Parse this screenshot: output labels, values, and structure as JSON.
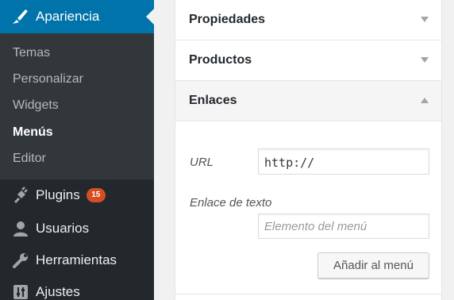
{
  "sidebar": {
    "active": {
      "label": "Apariencia",
      "icon": "brush-icon"
    },
    "submenu": [
      {
        "label": "Temas",
        "current": false
      },
      {
        "label": "Personalizar",
        "current": false
      },
      {
        "label": "Widgets",
        "current": false
      },
      {
        "label": "Menús",
        "current": true
      },
      {
        "label": "Editor",
        "current": false
      }
    ],
    "items": [
      {
        "label": "Plugins",
        "icon": "plugin-icon",
        "badge": "15"
      },
      {
        "label": "Usuarios",
        "icon": "user-icon"
      },
      {
        "label": "Herramientas",
        "icon": "wrench-icon"
      },
      {
        "label": "Ajustes",
        "icon": "settings-icon"
      }
    ]
  },
  "panel": {
    "sections": [
      {
        "title": "Propiedades",
        "expanded": false
      },
      {
        "title": "Productos",
        "expanded": false
      },
      {
        "title": "Enlaces",
        "expanded": true
      }
    ],
    "links_form": {
      "url_label": "URL",
      "url_value": "http://",
      "text_label": "Enlace de texto",
      "text_placeholder": "Elemento del menú",
      "add_button": "Añadir al menú"
    }
  },
  "colors": {
    "sidebar_bg": "#23282d",
    "submenu_bg": "#32373c",
    "active_bg": "#0073aa",
    "badge_bg": "#d54e21"
  }
}
